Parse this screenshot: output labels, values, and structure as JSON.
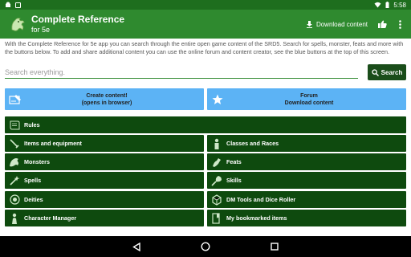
{
  "status_bar": {
    "time": "5:58",
    "left_icons": [
      "android-robot-icon",
      "dnd-app-icon"
    ],
    "right_icons": [
      "wifi-icon",
      "battery-icon"
    ]
  },
  "app_bar": {
    "title": "Complete Reference",
    "subtitle": "for 5e",
    "download_label": "Download content",
    "icons": [
      "dragon-logo-icon",
      "download-icon",
      "thumbs-up-icon",
      "overflow-menu-icon"
    ]
  },
  "description": "With the Complete Reference for 5e app you can search through the entire open game content of the SRD5. Search for spells, monster, feats and more with the buttons below. To add and share additional content you can use the online forum and content creator, see the blue buttons at the top of this screen.",
  "search": {
    "placeholder": "Search everything.",
    "value": "",
    "button_label": "Search"
  },
  "blue_buttons": [
    {
      "line1": "Create content!",
      "line2": "(opens in browser)",
      "icon": "create-content-icon"
    },
    {
      "line1": "Forum",
      "line2": "Download content",
      "icon": "star-icon"
    }
  ],
  "rules": {
    "label": "Rules",
    "icon": "scroll-icon"
  },
  "left_items": [
    {
      "label": "Items and equipment",
      "icon": "sword-icon"
    },
    {
      "label": "Monsters",
      "icon": "dragon-icon"
    },
    {
      "label": "Spells",
      "icon": "spell-icon"
    },
    {
      "label": "Deities",
      "icon": "deity-icon"
    },
    {
      "label": "Character Manager",
      "icon": "character-icon"
    }
  ],
  "right_items": [
    {
      "label": "Classes and Races",
      "icon": "classes-icon"
    },
    {
      "label": "Feats",
      "icon": "feats-icon"
    },
    {
      "label": "Skills",
      "icon": "skills-icon"
    },
    {
      "label": "DM Tools and Dice Roller",
      "icon": "dm-tools-icon"
    },
    {
      "label": "My bookmarked items",
      "icon": "bookmark-icon"
    }
  ],
  "colors": {
    "status_bar": "#1e6e1e",
    "app_bar": "#2f8a2f",
    "dark_green": "#0e4a0e",
    "blue": "#5cb3f5"
  }
}
